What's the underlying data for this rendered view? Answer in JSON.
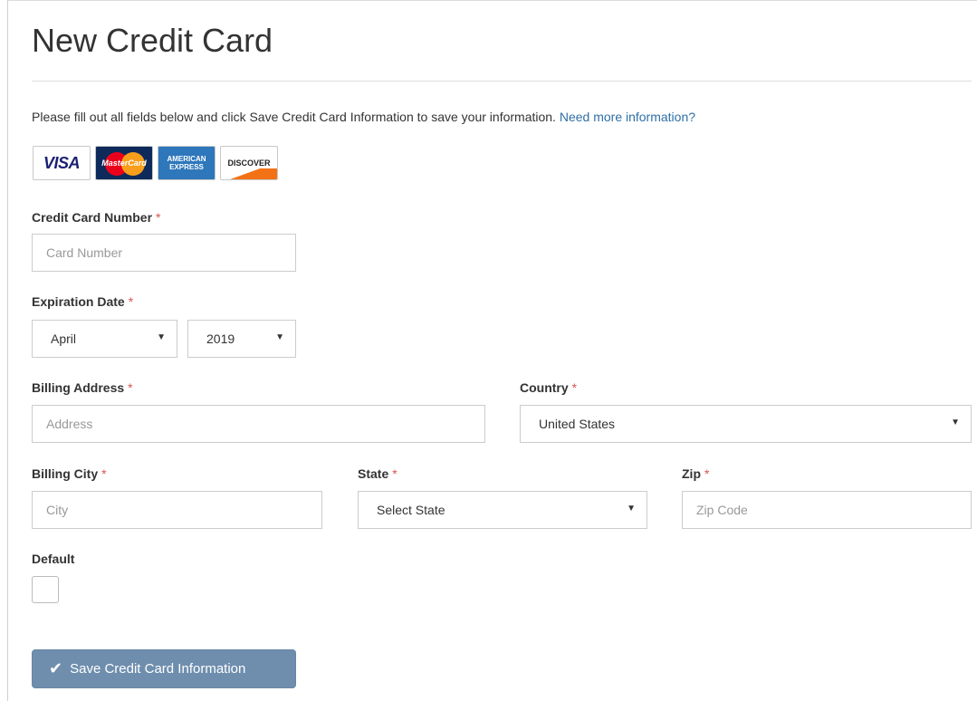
{
  "page": {
    "title": "New Credit Card",
    "intro_text": "Please fill out all fields below and click Save Credit Card Information to save your information.",
    "help_link": "Need more information?"
  },
  "card_logos": [
    "VISA",
    "MasterCard",
    "AMERICAN EXPRESS",
    "DISCOVER"
  ],
  "form": {
    "card_number": {
      "label": "Credit Card Number",
      "placeholder": "Card Number",
      "value": ""
    },
    "expiration": {
      "label": "Expiration Date",
      "month": "April",
      "year": "2019"
    },
    "billing_address": {
      "label": "Billing Address",
      "placeholder": "Address",
      "value": ""
    },
    "country": {
      "label": "Country",
      "value": "United States"
    },
    "billing_city": {
      "label": "Billing City",
      "placeholder": "City",
      "value": ""
    },
    "state": {
      "label": "State",
      "value": "Select State"
    },
    "zip": {
      "label": "Zip",
      "placeholder": "Zip Code",
      "value": ""
    },
    "default": {
      "label": "Default",
      "checked": false
    },
    "required_marker": "*"
  },
  "actions": {
    "save_label": "Save Credit Card Information"
  },
  "icons": {
    "check": "check-icon",
    "dropdown": "chevron-down-icon"
  },
  "colors": {
    "accent_link": "#2f6fa7",
    "required": "#d9534f",
    "button": "#6f8eae"
  }
}
